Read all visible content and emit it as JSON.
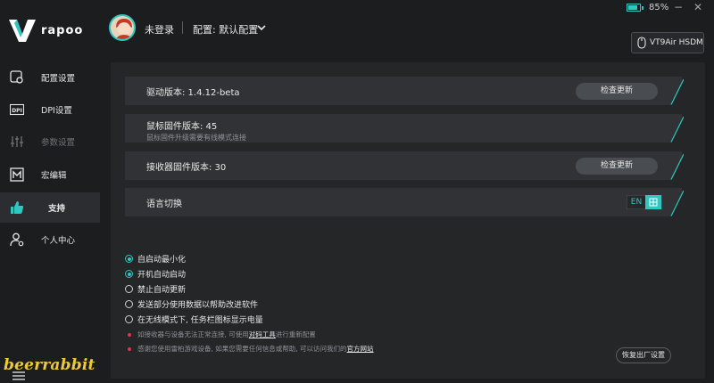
{
  "brand": {
    "logo_text": "rapoo"
  },
  "header": {
    "user_name": "未登录",
    "profile_label": "配置: 默认配置",
    "battery_percent": "85%",
    "battery_level": 0.85,
    "device_name": "VT9Air HSDM"
  },
  "sidebar": {
    "items": [
      {
        "label": "配置设置",
        "icon": "profile-settings-icon",
        "state": "normal"
      },
      {
        "label": "DPI设置",
        "icon": "dpi-icon",
        "state": "normal"
      },
      {
        "label": "参数设置",
        "icon": "sliders-icon",
        "state": "disabled"
      },
      {
        "label": "宏编辑",
        "icon": "macro-icon",
        "state": "normal"
      },
      {
        "label": "支持",
        "icon": "thumbs-up-icon",
        "state": "active"
      },
      {
        "label": "个人中心",
        "icon": "user-gear-icon",
        "state": "normal"
      }
    ]
  },
  "support": {
    "driver": {
      "label": "驱动版本: 1.4.12-beta",
      "button": "检查更新"
    },
    "mouse_fw": {
      "label": "鼠标固件版本: 45",
      "hint": "鼠标固件升级需要有线模式连接"
    },
    "receiver_fw": {
      "label": "接收器固件版本: 30",
      "button": "检查更新"
    },
    "language": {
      "label": "语言切换",
      "en": "EN"
    },
    "options": [
      {
        "label": "自启动最小化",
        "checked": true
      },
      {
        "label": "开机自动启动",
        "checked": true
      },
      {
        "label": "禁止自动更新",
        "checked": false
      },
      {
        "label": "发送部分使用数据以帮助改进软件",
        "checked": false
      },
      {
        "label": "在无线模式下, 任务栏图标显示电量",
        "checked": false
      }
    ],
    "notes": {
      "pair_before": "如接收器与设备无法正常连接, 可使用",
      "pair_link": "对码工具",
      "pair_after": "进行重新配置",
      "thanks_before": "感谢您使用雷柏游戏设备, 如果您需要任何信息或帮助, 可以访问我们的",
      "thanks_link": "官方网站"
    },
    "reset_button": "恢复出厂设置"
  },
  "watermark": "beerrabbit",
  "colors": {
    "accent": "#2fc7c0",
    "background": "#1c1d1f",
    "panel": "#242628",
    "card": "#303235",
    "note_dot": "#e0344a"
  }
}
